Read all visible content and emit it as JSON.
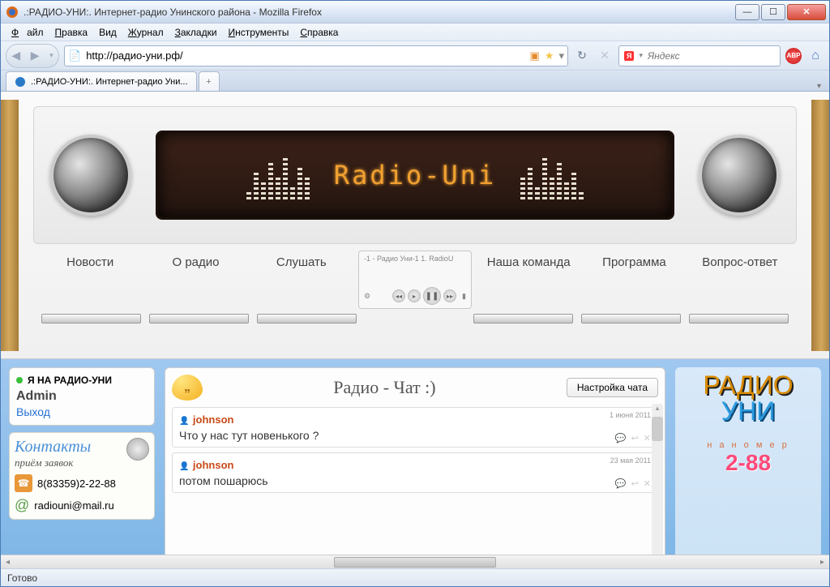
{
  "window": {
    "title": ".:РАДИО-УНИ:. Интернет-радио Унинского района - Mozilla Firefox"
  },
  "menu": {
    "file": "Файл",
    "edit": "Правка",
    "view": "Вид",
    "history": "Журнал",
    "bookmarks": "Закладки",
    "tools": "Инструменты",
    "help": "Справка"
  },
  "toolbar": {
    "url": "http://радио-уни.рф/",
    "search_placeholder": "Яндекс",
    "search_engine_badge": "Я"
  },
  "tabs": {
    "active": ".:РАДИО-УНИ:. Интернет-радио Уни..."
  },
  "radio": {
    "display_text": "Radio-Uni",
    "nav": [
      "Новости",
      "О радио",
      "Слушать",
      "Наша команда",
      "Программа",
      "Вопрос-ответ"
    ],
    "player_track": "-1 - Радио Уни-1  1. RadioU"
  },
  "sidebar": {
    "status_label": "Я НА РАДИО-УНИ",
    "user": "Admin",
    "logout": "Выход",
    "contacts_title": "Контакты",
    "contacts_sub": "приём заявок",
    "phone": "8(83359)2-22-88",
    "email": "radiouni@mail.ru"
  },
  "chat": {
    "title": "Радио - Чат :)",
    "config_button": "Настройка чата",
    "messages": [
      {
        "author": "johnson",
        "date": "1 июня 2011",
        "body": "Что у нас тут новенького ?"
      },
      {
        "author": "johnson",
        "date": "23 мая 2011",
        "body": "потом пошарюсь"
      }
    ]
  },
  "banner": {
    "line1": "РАДИО",
    "line2": "УНИ",
    "sub": "н а   н о м е р",
    "num": "2-88"
  },
  "status": {
    "text": "Готово"
  }
}
